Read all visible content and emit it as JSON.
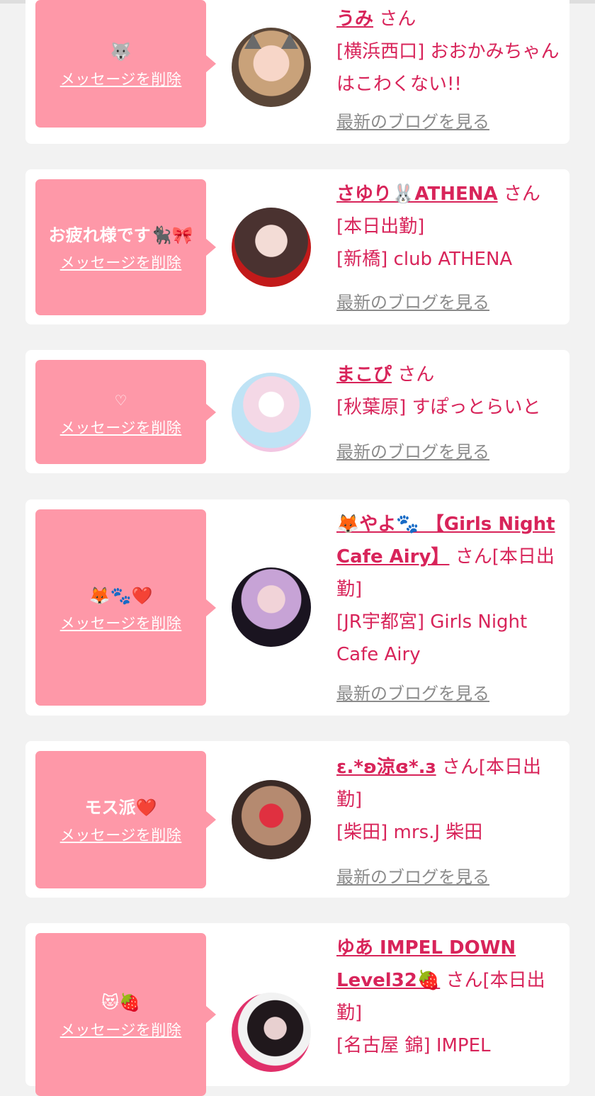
{
  "delete_label": "メッセージを削除",
  "blog_label": "最新のブログを見る",
  "cards": [
    {
      "message": "🐺",
      "name": "うみ",
      "name_tail": "  さん",
      "shop": "[横浜西口] おおかみちゃんはこわくない!!"
    },
    {
      "message": "お疲れ様です🐈‍⬛🎀",
      "name": "さゆり🐰ATHENA",
      "name_tail": "  さん[本日出勤]",
      "shop": "[新橋] club ATHENA"
    },
    {
      "message": "♡",
      "name": "まこぴ",
      "name_tail": "  さん",
      "shop": "[秋葉原] すぽっとらいと"
    },
    {
      "message": "🦊🐾❤️",
      "name": "🦊やよ🐾 【Girls Night Cafe Airy】",
      "name_tail": "  さん[本日出勤]",
      "shop": "[JR宇都宮] Girls Night Cafe Airy"
    },
    {
      "message": "モス派❤️",
      "name": "ε.*ʚ涼ɞ*.з",
      "name_tail": "  さん[本日出勤]",
      "shop": "[柴田] mrs.J 柴田"
    },
    {
      "message": "😻🍓",
      "name": "ゆあ IMPEL DOWN Level32🍓",
      "name_tail": "  さん[本日出勤]",
      "shop": "[名古屋 錦] IMPEL"
    }
  ]
}
